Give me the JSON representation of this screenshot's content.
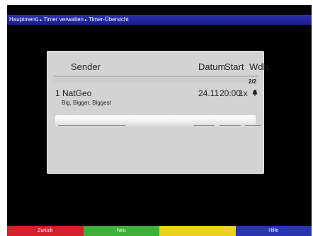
{
  "breadcrumb": {
    "items": [
      "Hauptmenü",
      "Timer verwalten",
      "Timer-Übersicht"
    ],
    "separator": "▸"
  },
  "table": {
    "headers": {
      "sender": "Sender",
      "datum": "Datum",
      "start": "Start",
      "wdh": "Wdh."
    },
    "page_indicator": "2/2",
    "rows": [
      {
        "index": "1",
        "sender": "NatGeo",
        "subtitle": "Big, Bigger, Biggest",
        "datum": "24.11",
        "start": "20:00",
        "wdh": "1x",
        "icon": "bell-icon"
      }
    ]
  },
  "color_buttons": {
    "red": "Zurück",
    "green": "Neu",
    "yellow": "",
    "blue": "Hilfe"
  },
  "colors": {
    "red": "#d4222c",
    "green": "#3fb038",
    "yellow": "#ecd21c",
    "blue": "#2a35b0",
    "title_bar": "#1f24a0"
  }
}
